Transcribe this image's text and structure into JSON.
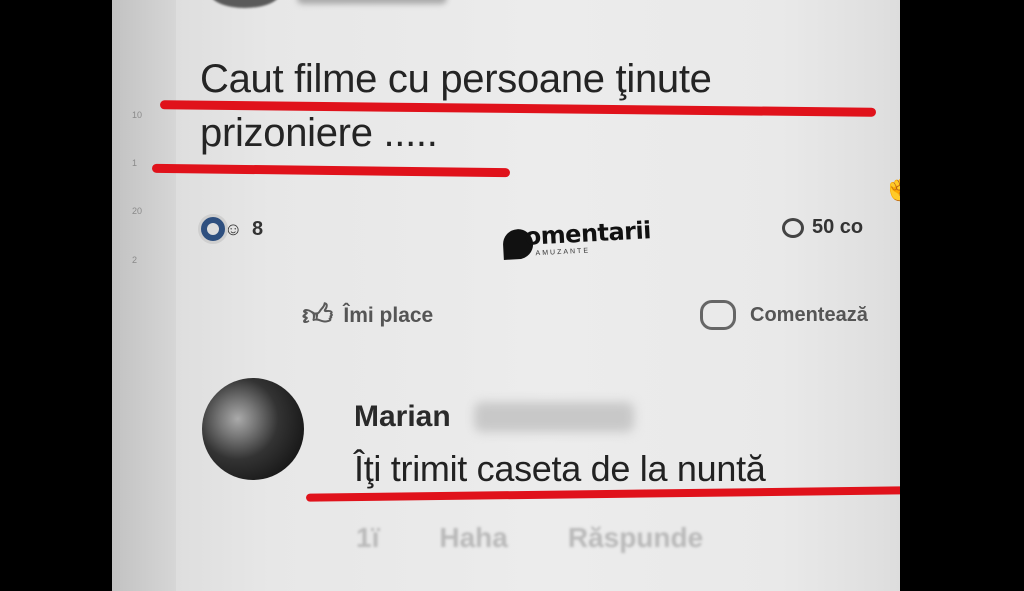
{
  "post": {
    "text": "Caut filme cu persoane ţinute prizoniere .....",
    "reaction_count": "8",
    "comments_count": "50 co"
  },
  "watermark": {
    "text": "omentarii",
    "sub": "AMUZANTE"
  },
  "actions": {
    "like_label": "Îmi place",
    "comment_label": "Comentează"
  },
  "comment": {
    "author": "Marian",
    "text": "Îţi trimit caseta de la nuntă",
    "actions": [
      "1ï",
      "Haha",
      "Răspunde"
    ]
  },
  "colors": {
    "highlight_underline": "#e0121b",
    "background": "#000000",
    "screen": "#e9e9e9"
  },
  "icons": [
    "like-reaction-icon",
    "haha-reaction-icon",
    "comment-bubble-icon",
    "thumbs-up-icon",
    "hand-cursor-icon",
    "avatar"
  ]
}
